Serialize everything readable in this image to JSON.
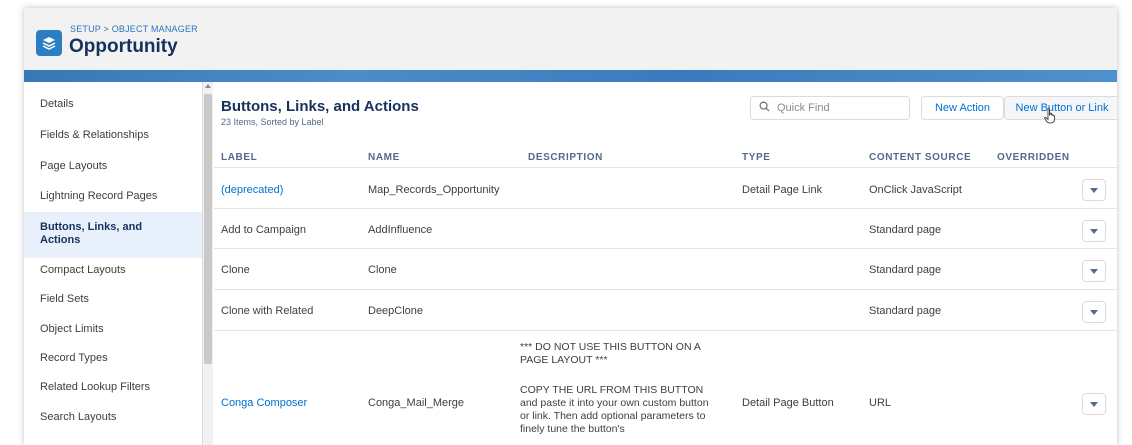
{
  "header": {
    "breadcrumb": "SETUP > OBJECT MANAGER",
    "title": "Opportunity",
    "icon": "layers-icon",
    "accent": "#2b7ec4"
  },
  "sidebar": {
    "items": [
      {
        "label": "Details"
      },
      {
        "label": "Fields & Relationships"
      },
      {
        "label": "Page Layouts"
      },
      {
        "label": "Lightning Record Pages"
      },
      {
        "label": "Buttons, Links, and Actions",
        "active": true
      },
      {
        "label": "Compact Layouts"
      },
      {
        "label": "Field Sets"
      },
      {
        "label": "Object Limits"
      },
      {
        "label": "Record Types"
      },
      {
        "label": "Related Lookup Filters"
      },
      {
        "label": "Search Layouts"
      }
    ]
  },
  "main": {
    "title": "Buttons, Links, and Actions",
    "subtitle": "23 Items, Sorted by Label",
    "search": {
      "placeholder": "Quick Find",
      "value": ""
    },
    "buttons": {
      "new_action": "New Action",
      "new_button_or_link": "New Button or Link"
    },
    "columns": [
      "LABEL",
      "NAME",
      "DESCRIPTION",
      "TYPE",
      "CONTENT SOURCE",
      "OVERRIDDEN"
    ],
    "rows": [
      {
        "label": "(deprecated)",
        "label_is_link": true,
        "name": "Map_Records_Opportunity",
        "description": [],
        "type": "Detail Page Link",
        "content_source": "OnClick JavaScript",
        "overridden": ""
      },
      {
        "label": "Add to Campaign",
        "label_is_link": false,
        "name": "AddInfluence",
        "description": [],
        "type": "",
        "content_source": "Standard page",
        "overridden": ""
      },
      {
        "label": "Clone",
        "label_is_link": false,
        "name": "Clone",
        "description": [],
        "type": "",
        "content_source": "Standard page",
        "overridden": ""
      },
      {
        "label": "Clone with Related",
        "label_is_link": false,
        "name": "DeepClone",
        "description": [],
        "type": "",
        "content_source": "Standard page",
        "overridden": ""
      },
      {
        "label": "Conga Composer",
        "label_is_link": true,
        "name": "Conga_Mail_Merge",
        "description": [
          "*** DO NOT USE THIS BUTTON ON A PAGE LAYOUT ***",
          "COPY THE URL FROM THIS BUTTON and paste it into your own custom button or link. Then add optional parameters to finely tune the button's"
        ],
        "type": "Detail Page Button",
        "content_source": "URL",
        "overridden": ""
      }
    ]
  }
}
